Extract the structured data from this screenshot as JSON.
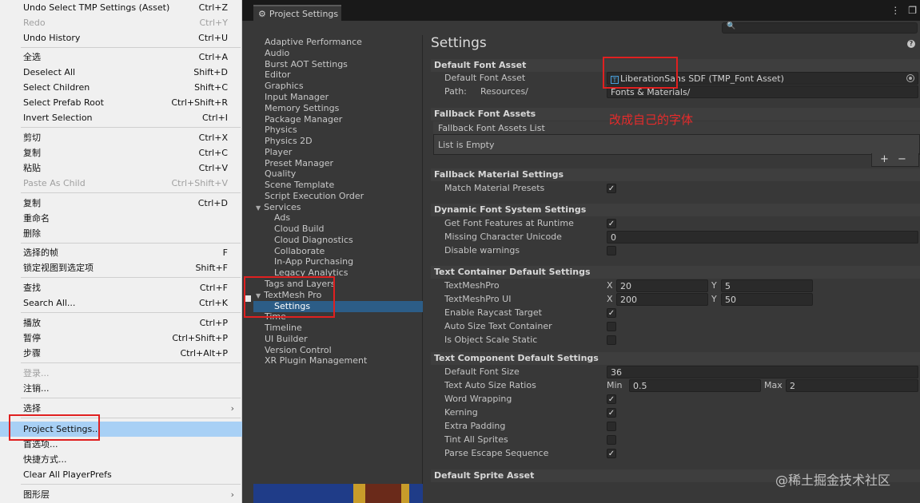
{
  "menu": {
    "items": [
      {
        "label": "Undo Select TMP Settings (Asset)",
        "shortcut": "Ctrl+Z"
      },
      {
        "label": "Redo",
        "shortcut": "Ctrl+Y"
      },
      {
        "label": "Undo History",
        "shortcut": "Ctrl+U"
      },
      {
        "label": "全选",
        "shortcut": "Ctrl+A"
      },
      {
        "label": "Deselect All",
        "shortcut": "Shift+D"
      },
      {
        "label": "Select Children",
        "shortcut": "Shift+C"
      },
      {
        "label": "Select Prefab Root",
        "shortcut": "Ctrl+Shift+R"
      },
      {
        "label": "Invert Selection",
        "shortcut": "Ctrl+I"
      },
      {
        "label": "剪切",
        "shortcut": "Ctrl+X"
      },
      {
        "label": "复制",
        "shortcut": "Ctrl+C"
      },
      {
        "label": "粘贴",
        "shortcut": "Ctrl+V"
      },
      {
        "label": "Paste As Child",
        "shortcut": "Ctrl+Shift+V"
      },
      {
        "label": "复制",
        "shortcut": "Ctrl+D"
      },
      {
        "label": "重命名",
        "shortcut": ""
      },
      {
        "label": "删除",
        "shortcut": ""
      },
      {
        "label": "选择的帧",
        "shortcut": "F"
      },
      {
        "label": "锁定视图到选定项",
        "shortcut": "Shift+F"
      },
      {
        "label": "查找",
        "shortcut": "Ctrl+F"
      },
      {
        "label": "Search All...",
        "shortcut": "Ctrl+K"
      },
      {
        "label": "播放",
        "shortcut": "Ctrl+P"
      },
      {
        "label": "暂停",
        "shortcut": "Ctrl+Shift+P"
      },
      {
        "label": "步骤",
        "shortcut": "Ctrl+Alt+P"
      },
      {
        "label": "登录...",
        "shortcut": ""
      },
      {
        "label": "注销...",
        "shortcut": ""
      },
      {
        "label": "选择",
        "shortcut": ""
      },
      {
        "label": "Project Settings...",
        "shortcut": ""
      },
      {
        "label": "首选项...",
        "shortcut": ""
      },
      {
        "label": "快捷方式...",
        "shortcut": ""
      },
      {
        "label": "Clear All PlayerPrefs",
        "shortcut": ""
      },
      {
        "label": "图形层",
        "shortcut": ""
      }
    ]
  },
  "window": {
    "tab_title": "Project Settings",
    "tab_icon": "gear-icon",
    "controls": [
      "⋮",
      "❐"
    ]
  },
  "nav": {
    "items": [
      "Adaptive Performance",
      "Audio",
      "Burst AOT Settings",
      "Editor",
      "Graphics",
      "Input Manager",
      "Memory Settings",
      "Package Manager",
      "Physics",
      "Physics 2D",
      "Player",
      "Preset Manager",
      "Quality",
      "Scene Template",
      "Script Execution Order",
      "Services",
      "Ads",
      "Cloud Build",
      "Cloud Diagnostics",
      "Collaborate",
      "In-App Purchasing",
      "Legacy Analytics",
      "Tags and Layers",
      "TextMesh Pro",
      "Settings",
      "Time",
      "Timeline",
      "UI Builder",
      "Version Control",
      "XR Plugin Management"
    ],
    "selected": "Settings"
  },
  "settings": {
    "title": "Settings",
    "default_font_asset": {
      "header": "Default Font Asset",
      "label": "Default Font Asset",
      "value": "LiberationSans SDF (TMP_Font Asset)",
      "path_label": "Path:",
      "path_prefix": "Resources/",
      "path_value": "Fonts & Materials/"
    },
    "fallback_font": {
      "header": "Fallback Font Assets",
      "list_title": "Fallback Font Assets List",
      "empty_text": "List is Empty",
      "add": "+",
      "remove": "−"
    },
    "fallback_material": {
      "header": "Fallback Material Settings",
      "match_label": "Match Material Presets"
    },
    "dynamic_font": {
      "header": "Dynamic Font System Settings",
      "features_label": "Get Font Features at Runtime",
      "missing_label": "Missing Character Unicode",
      "missing_value": "0",
      "disable_label": "Disable warnings"
    },
    "text_container": {
      "header": "Text Container Default Settings",
      "tmp_label": "TextMeshPro",
      "tmp_x": "20",
      "tmp_y": "5",
      "ui_label": "TextMeshPro UI",
      "ui_x": "200",
      "ui_y": "50",
      "x": "X",
      "y": "Y",
      "raycast_label": "Enable Raycast Target",
      "autosize_label": "Auto Size Text Container",
      "scale_label": "Is Object Scale Static"
    },
    "text_component": {
      "header": "Text Component Default Settings",
      "font_size_label": "Default Font Size",
      "font_size_value": "36",
      "ratios_label": "Text Auto Size Ratios",
      "min_label": "Min",
      "min_value": "0.5",
      "max_label": "Max",
      "max_value": "2",
      "wrap_label": "Word Wrapping",
      "kerning_label": "Kerning",
      "padding_label": "Extra Padding",
      "tint_label": "Tint All Sprites",
      "escape_label": "Parse Escape Sequence"
    },
    "sprite": {
      "header": "Default Sprite Asset"
    }
  },
  "annotation": "改成自己的字体",
  "watermark": "@稀土掘金技术社区",
  "colors": {
    "annotation_red": "#e02020",
    "selection_blue": "#2c5d87",
    "menu_highlight": "#a8d0f5"
  }
}
